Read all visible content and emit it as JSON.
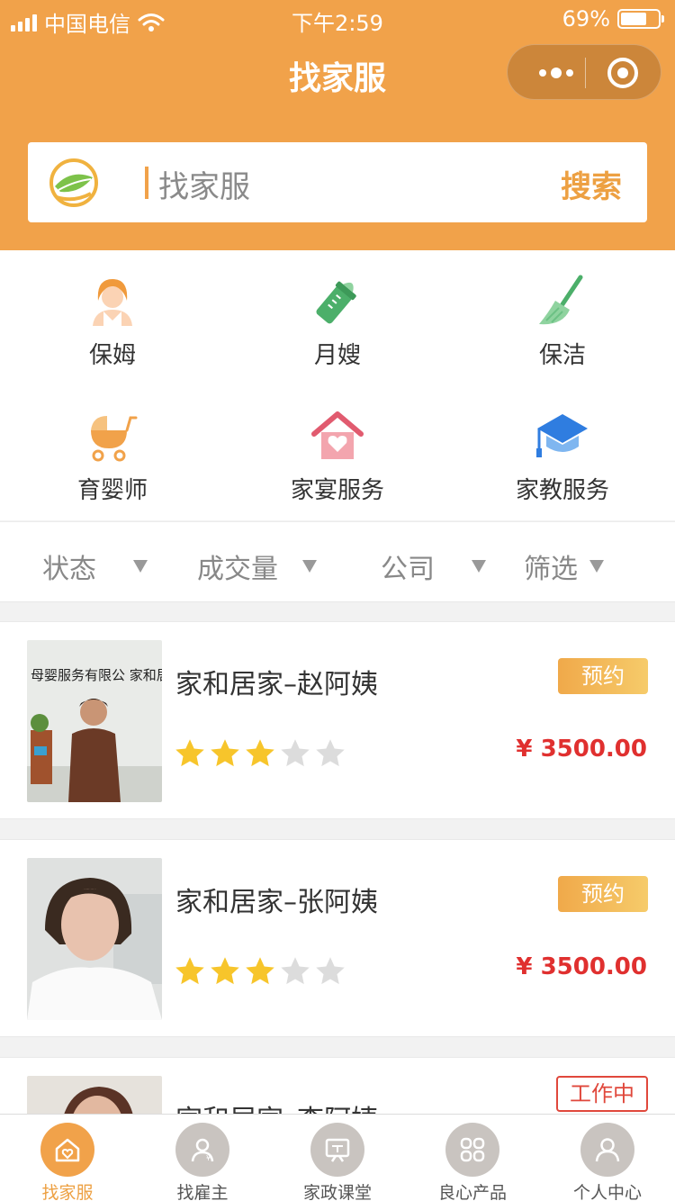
{
  "status_bar": {
    "carrier": "中国电信",
    "time": "下午2:59",
    "battery": "69%",
    "battery_level": 0.69
  },
  "header": {
    "title": "找家服"
  },
  "search": {
    "placeholder": "找家服",
    "button_label": "搜索"
  },
  "categories": [
    {
      "label": "保姆",
      "icon": "nanny-icon"
    },
    {
      "label": "月嫂",
      "icon": "baby-bottle-icon"
    },
    {
      "label": "保洁",
      "icon": "broom-icon"
    },
    {
      "label": "育婴师",
      "icon": "stroller-icon"
    },
    {
      "label": "家宴服务",
      "icon": "house-heart-icon"
    },
    {
      "label": "家教服务",
      "icon": "graduation-cap-icon"
    }
  ],
  "filters": [
    {
      "label": "状态"
    },
    {
      "label": "成交量"
    },
    {
      "label": "公司"
    },
    {
      "label": "筛选"
    }
  ],
  "listings": [
    {
      "name": "家和居家–赵阿姨",
      "action": "预约",
      "action_style": "book",
      "price": "¥ 3500.00",
      "rating": 3,
      "rating_max": 5,
      "photo_text": "母婴服务有限公 家和居家"
    },
    {
      "name": "家和居家–张阿姨",
      "action": "预约",
      "action_style": "book",
      "price": "¥ 3500.00",
      "rating": 3,
      "rating_max": 5
    },
    {
      "name": "家和居家–李阿姨",
      "action": "工作中",
      "action_style": "busy"
    }
  ],
  "tabbar": [
    {
      "label": "找家服",
      "icon": "home-icon",
      "active": true
    },
    {
      "label": "找雇主",
      "icon": "employer-icon",
      "active": false
    },
    {
      "label": "家政课堂",
      "icon": "classroom-icon",
      "active": false
    },
    {
      "label": "良心产品",
      "icon": "products-icon",
      "active": false
    },
    {
      "label": "个人中心",
      "icon": "profile-icon",
      "active": false
    }
  ],
  "colors": {
    "brand_orange": "#f1a24a",
    "price_red": "#e0302f",
    "star_yellow": "#f7c52b",
    "star_gray": "#dcdcdc"
  }
}
